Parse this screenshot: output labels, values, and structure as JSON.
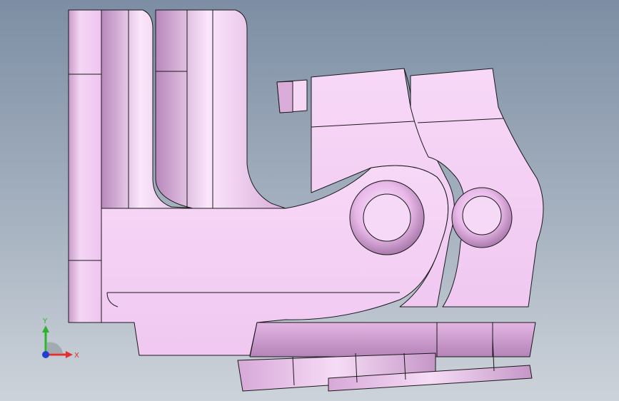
{
  "viewport": {
    "background_top": "#7d8ea4",
    "background_bottom": "#cdd3da"
  },
  "model": {
    "part_color": "#f2cdf2",
    "shade_color": "#c59ac6",
    "edge_color": "#1a1a1a"
  },
  "triad": {
    "x_label": "X",
    "y_label": "Y",
    "x_color": "#e03030",
    "y_color": "#30b030",
    "z_color": "#2040d0"
  }
}
